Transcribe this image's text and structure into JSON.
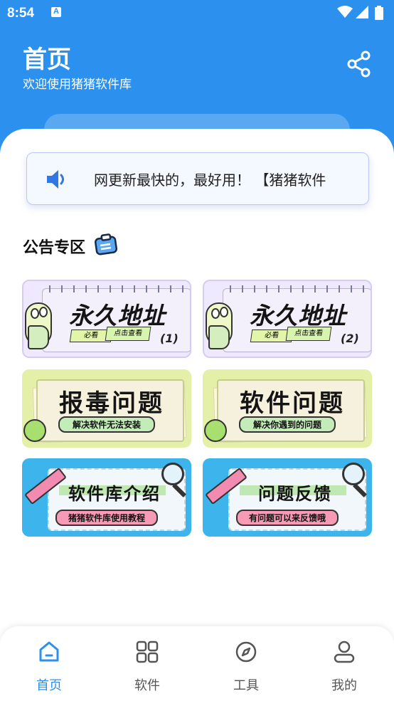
{
  "status_bar": {
    "time": "8:54",
    "app_icon": "A"
  },
  "header": {
    "title": "首页",
    "subtitle": "欢迎使用猪猪软件库",
    "share_icon": "share-icon"
  },
  "notice": {
    "icon": "speaker-icon",
    "text": "网更新最快的，最好用！  【猪猪软件"
  },
  "section": {
    "title": "公告专区",
    "icon": "clipboard-icon"
  },
  "cards": [
    {
      "title": "永久地址",
      "tag_a": "必看",
      "tag_b": "点击查看",
      "number": "(1)"
    },
    {
      "title": "永久地址",
      "tag_a": "必看",
      "tag_b": "点击查看",
      "number": "(2)"
    },
    {
      "title": "报毒问题",
      "subtitle": "解决软件无法安装"
    },
    {
      "title": "软件问题",
      "subtitle": "解决你遇到的问题"
    },
    {
      "title": "软件库介绍",
      "subtitle": "猪猪软件库使用教程"
    },
    {
      "title": "问题反馈",
      "subtitle": "有问题可以来反馈哦"
    }
  ],
  "tabs": [
    {
      "label": "首页",
      "icon": "home-icon",
      "active": true
    },
    {
      "label": "软件",
      "icon": "grid-icon",
      "active": false
    },
    {
      "label": "工具",
      "icon": "compass-icon",
      "active": false
    },
    {
      "label": "我的",
      "icon": "person-icon",
      "active": false
    }
  ],
  "colors": {
    "primary": "#2b90ee",
    "text": "#111111",
    "inactive_tab": "#555555"
  }
}
